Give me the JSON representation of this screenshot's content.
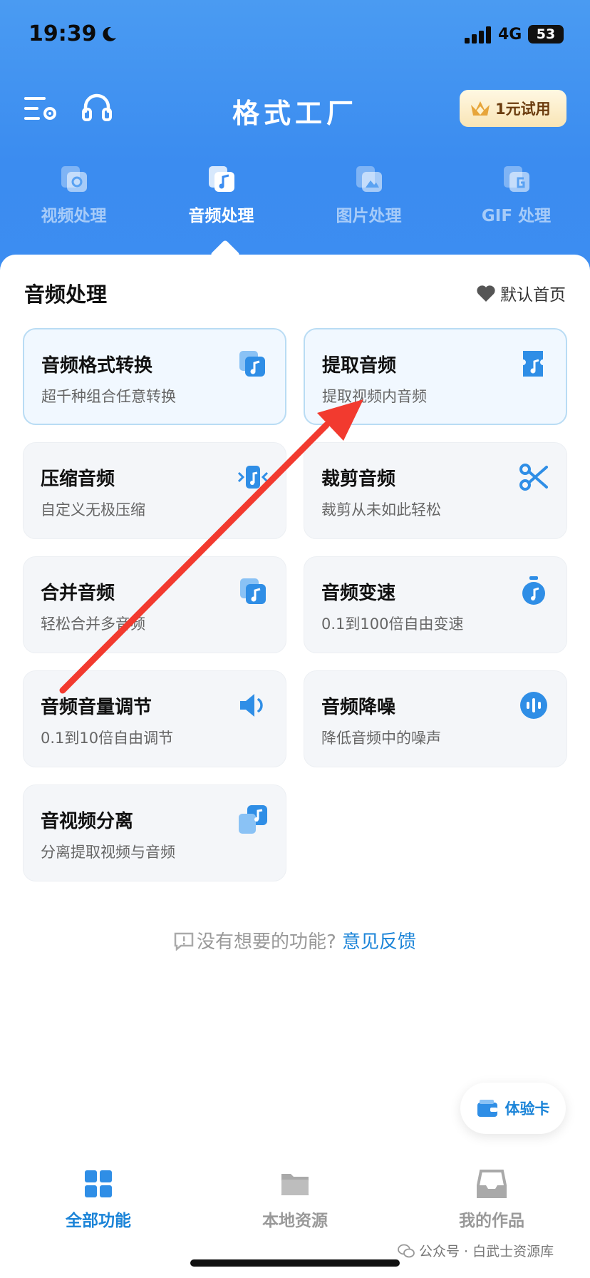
{
  "status_bar": {
    "time": "19:39",
    "network": "4G",
    "battery": "53"
  },
  "header": {
    "title": "格式工厂",
    "trial_button": "1元试用"
  },
  "category_tabs": [
    {
      "label": "视频处理",
      "icon": "video-icon",
      "active": false
    },
    {
      "label": "音频处理",
      "icon": "audio-icon",
      "active": true
    },
    {
      "label": "图片处理",
      "icon": "image-icon",
      "active": false
    },
    {
      "label": "GIF 处理",
      "icon": "gif-icon",
      "active": false
    }
  ],
  "section": {
    "title": "音频处理",
    "default_home": "默认首页"
  },
  "cards": [
    {
      "title": "音频格式转换",
      "subtitle": "超千种组合任意转换",
      "icon": "audio-convert-icon"
    },
    {
      "title": "提取音频",
      "subtitle": "提取视频内音频",
      "icon": "audio-extract-icon"
    },
    {
      "title": "压缩音频",
      "subtitle": "自定义无极压缩",
      "icon": "audio-compress-icon"
    },
    {
      "title": "裁剪音频",
      "subtitle": "裁剪从未如此轻松",
      "icon": "scissors-icon"
    },
    {
      "title": "合并音频",
      "subtitle": "轻松合并多音频",
      "icon": "audio-merge-icon"
    },
    {
      "title": "音频变速",
      "subtitle": "0.1到100倍自由变速",
      "icon": "stopwatch-icon"
    },
    {
      "title": "音频音量调节",
      "subtitle": "0.1到10倍自由调节",
      "icon": "volume-icon"
    },
    {
      "title": "音频降噪",
      "subtitle": "降低音频中的噪声",
      "icon": "noise-reduction-icon"
    },
    {
      "title": "音视频分离",
      "subtitle": "分离提取视频与音频",
      "icon": "av-separate-icon"
    }
  ],
  "feedback": {
    "question": "没有想要的功能?",
    "link": "意见反馈"
  },
  "experience_card": "体验卡",
  "bottom_nav": [
    {
      "label": "全部功能",
      "icon": "grid-icon",
      "active": true
    },
    {
      "label": "本地资源",
      "icon": "folder-icon",
      "active": false
    },
    {
      "label": "我的作品",
      "icon": "inbox-icon",
      "active": false
    }
  ],
  "watermark": "公众号 · 白武士资源库",
  "colors": {
    "header_blue": "#3c8df1",
    "accent": "#1b84d8",
    "arrow_red": "#f23a2f"
  }
}
